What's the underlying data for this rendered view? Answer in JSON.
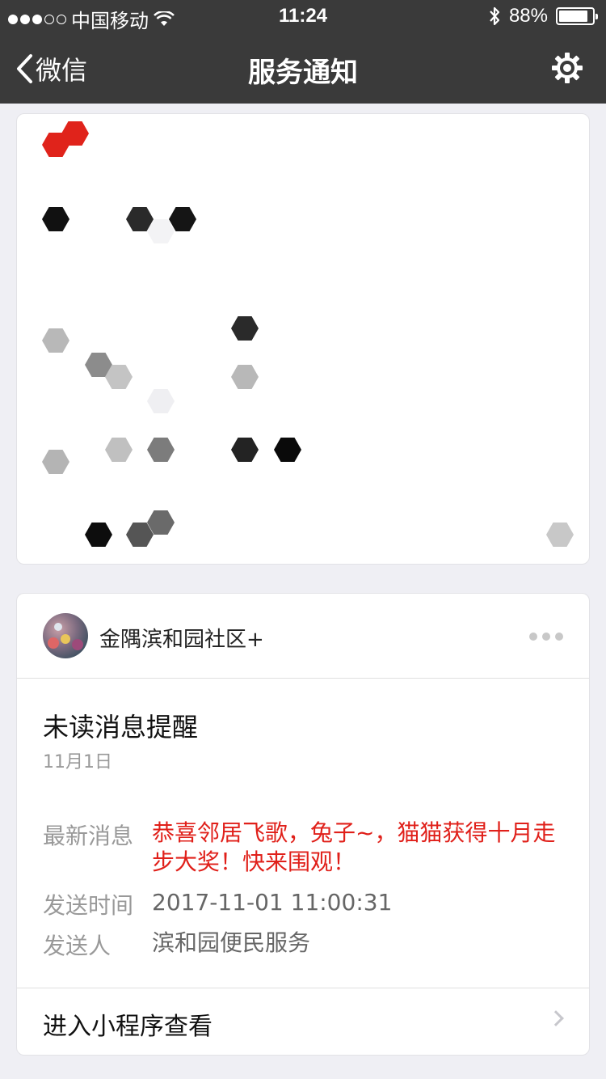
{
  "status_bar": {
    "carrier": "中国移动",
    "time": "11:24",
    "battery": "88%",
    "battery_level": 0.88,
    "signal_bars_filled": 3,
    "signal_bars_total": 5,
    "icons": [
      "wifi-icon",
      "bluetooth-icon",
      "battery-icon"
    ]
  },
  "nav": {
    "back_label": "微信",
    "title": "服务通知",
    "settings_icon": "gear-icon"
  },
  "notification": {
    "account_name": "金隅滨和园社区+",
    "title": "未读消息提醒",
    "date": "11月1日",
    "fields": [
      {
        "label": "最新消息",
        "value": "恭喜邻居飞歌，兔子~，猫猫获得十月走步大奖！快来围观！",
        "highlight": true
      },
      {
        "label": "发送时间",
        "value": "2017-11-01 11:00:31",
        "highlight": false
      },
      {
        "label": "发送人",
        "value": "滨和园便民服务",
        "highlight": false
      }
    ],
    "footer_label": "进入小程序查看"
  },
  "colors": {
    "nav_background": "#3a3a3a",
    "page_background": "#efeff4",
    "highlight_red": "#e0201a",
    "muted_text": "#999999"
  }
}
